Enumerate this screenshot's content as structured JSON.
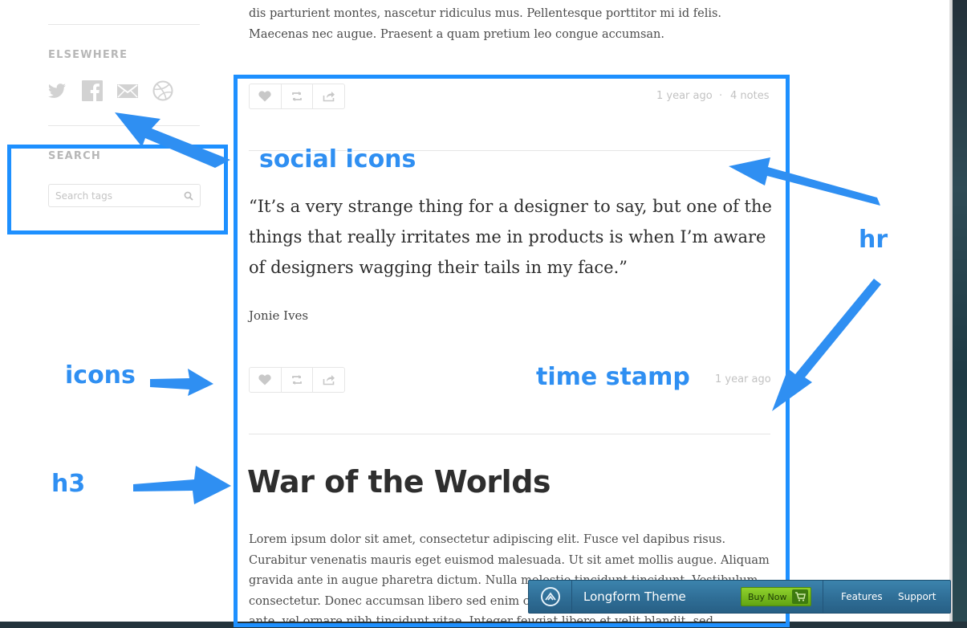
{
  "intro": {
    "text": "dis parturient montes, nascetur ridiculus mus. Pellentesque porttitor mi id felis. Maecenas nec augue. Praesent a quam pretium leo congue accumsan."
  },
  "sidebar": {
    "elsewhere_heading": "ELSEWHERE",
    "social_icons": [
      "twitter-icon",
      "facebook-icon",
      "mail-icon",
      "dribbble-icon"
    ],
    "search_heading": "SEARCH",
    "search_placeholder": "Search tags"
  },
  "post1": {
    "time": "1 year ago",
    "separator": "·",
    "notes": "4 notes"
  },
  "post2": {
    "quote": "“It’s a very strange thing for a designer to say, but one of the things that really irritates me in products is when I’m aware of designers wagging their tails in my face.”",
    "attribution": "Jonie Ives",
    "time": "1 year ago"
  },
  "post3": {
    "title": "War of the Worlds",
    "body": "Lorem ipsum dolor sit amet, consectetur adipiscing elit. Fusce vel dapibus risus. Curabitur venenatis mauris eget euismod malesuada. Ut sit amet mollis augue. Aliquam gravida ante in augue pharetra dictum. Nulla molestie tincidunt tincidunt. Vestibulum consectetur. Donec accumsan libero sed enim consequat sagittis. Donec sodales mollis ante, vel ornare nibh tincidunt vitae. Integer feugiat libero et velit blandit, sed fermentum urna porttitor."
  },
  "action_icons": [
    "heart-icon",
    "reblog-icon",
    "share-icon"
  ],
  "annotations": {
    "social_icons": "social icons",
    "hr": "hr",
    "icons": "icons",
    "time_stamp": "time stamp",
    "h3": "h3",
    "accent": "#2f8ff2"
  },
  "theme_bar": {
    "name": "Longform Theme",
    "buy_now": "Buy Now",
    "features": "Features",
    "support": "Support"
  }
}
